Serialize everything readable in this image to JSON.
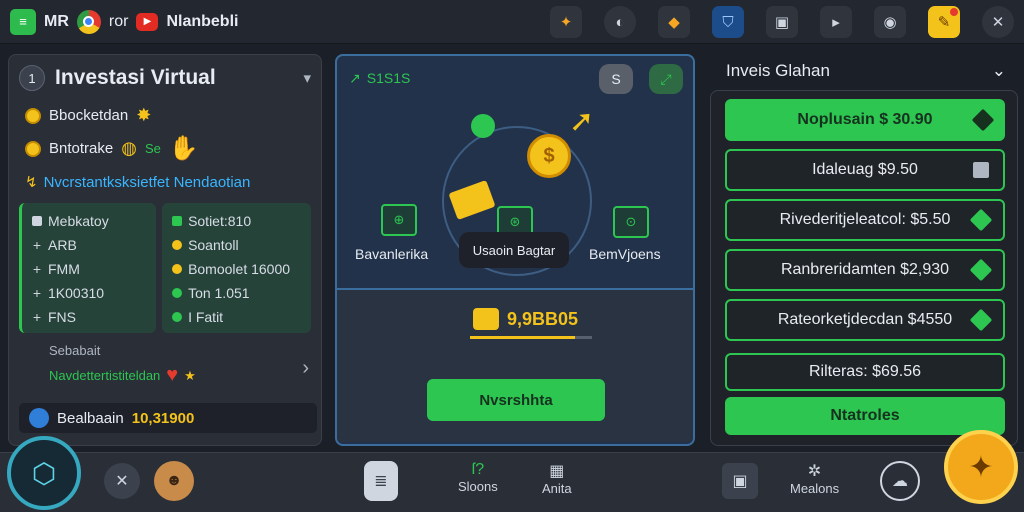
{
  "topbar": {
    "logo_text": "MR",
    "app_text": "ror",
    "brand": "Nlanbebli",
    "icons": [
      "badge-icon",
      "half-moon-icon",
      "shape-icon",
      "shield-icon",
      "lock-icon",
      "play-icon",
      "eye-icon",
      "notification-icon",
      "close-icon"
    ]
  },
  "left": {
    "number": "1",
    "title": "Investasi Virtual",
    "line1": "Bbocketdan",
    "line2": "Bntotrake",
    "line2_extra": "Se",
    "link": "Nvcrstantksksietfet Nendaotian",
    "grid_left": [
      {
        "text": "Mebkatoy"
      },
      {
        "text": "ARB"
      },
      {
        "text": "FMM"
      },
      {
        "text": "1K00310"
      },
      {
        "text": "FNS"
      }
    ],
    "grid_right": [
      {
        "text": "Sotiet:810"
      },
      {
        "text": "Soantoll"
      },
      {
        "text": "Bomoolet 16000"
      },
      {
        "text": "Ton 1.051"
      },
      {
        "text": "I Fatit"
      }
    ],
    "bottom_small": "Sebabait",
    "bottom_green": "Navdettertistiteldan",
    "balance_label": "Bealbaain",
    "balance_value": "10,31900"
  },
  "center": {
    "tag": "S1S1S",
    "btn_a": "S",
    "label_left": "Bavanlerika",
    "label_center": "Usaoin Bagtar",
    "label_right": "BemVjoens",
    "value": "9,9BB05",
    "progress": 0.86,
    "button": "Nvsrshhta"
  },
  "right": {
    "title": "Inveis Glahan",
    "rows": [
      {
        "text": "Noplusain $ 30.90",
        "style": "filled"
      },
      {
        "text": "Idaleuag $9.50",
        "style": "outlined"
      },
      {
        "text": "Rivederitjeleatcol: $5.50",
        "style": "outlined"
      },
      {
        "text": "Ranbreridamten $2,930",
        "style": "outlined"
      },
      {
        "text": "Rateorketjdecdan $4550",
        "style": "outlined"
      },
      {
        "text": "Rilteras: $69.56",
        "style": "outlined"
      },
      {
        "text": "Ntatroles",
        "style": "filled"
      }
    ]
  },
  "bottom": {
    "tab1": "Sloons",
    "tab2": "Anita",
    "tab3": "Mealons"
  },
  "colors": {
    "accent_green": "#2cc651",
    "accent_yellow": "#f3c21b",
    "background": "#1b1f27"
  }
}
